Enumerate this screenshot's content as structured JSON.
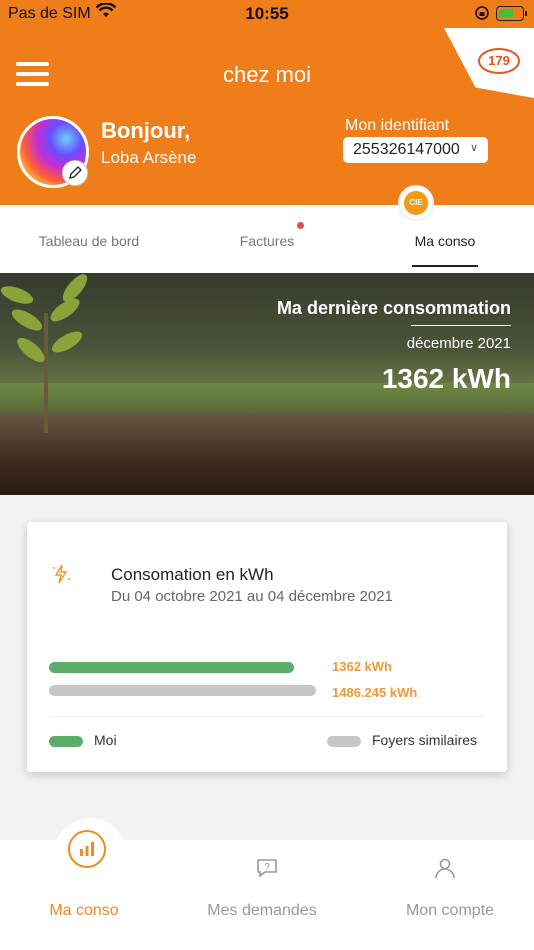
{
  "status_bar": {
    "carrier": "Pas de SIM",
    "time": "10:55"
  },
  "header": {
    "title": "chez moi",
    "logo_text": "179"
  },
  "profile": {
    "greeting": "Bonjour,",
    "name": "Loba Arsène",
    "id_label": "Mon identifiant",
    "id_value": "255326147000"
  },
  "tabs": [
    {
      "label": "Tableau de bord",
      "active": false
    },
    {
      "label": "Factures",
      "active": false,
      "has_notification": true
    },
    {
      "label": "Ma conso",
      "active": true
    }
  ],
  "brand_badge": {
    "text": "CIE"
  },
  "hero": {
    "title": "Ma dernière consommation",
    "month": "décembre 2021",
    "value": "1362 kWh"
  },
  "card": {
    "title": "Consomation en  kWh",
    "period": "Du 04 octobre 2021 au 04 décembre 2021",
    "bars": [
      {
        "value_label": "1362 kWh",
        "value": 1362,
        "color": "#5aae6a"
      },
      {
        "value_label": "1486.245  kWh",
        "value": 1486.245,
        "color": "#c7c7c7"
      }
    ],
    "legend": {
      "me": "Moi",
      "similar": "Foyers similaires"
    }
  },
  "bottom_nav": [
    {
      "label": "Ma conso",
      "icon": "bar-chart-icon",
      "active": true
    },
    {
      "label": "Mes demandes",
      "icon": "question-bubble-icon",
      "active": false
    },
    {
      "label": "Mon compte",
      "icon": "user-icon",
      "active": false
    }
  ],
  "colors": {
    "accent": "#ef7d1a",
    "green": "#5aae6a",
    "grey": "#c7c7c7",
    "value_orange": "#ef9a3a"
  }
}
